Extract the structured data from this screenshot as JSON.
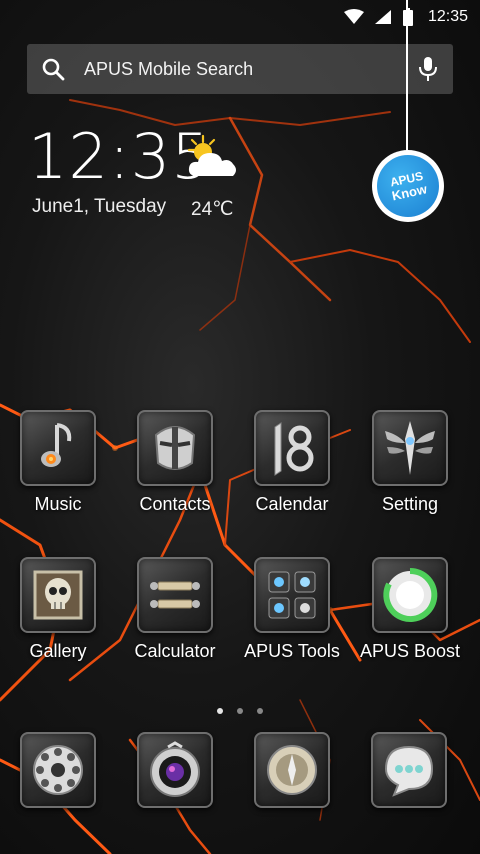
{
  "status_bar": {
    "time": "12:35",
    "icons": [
      "wifi-icon",
      "cell-signal-icon",
      "battery-icon"
    ]
  },
  "search": {
    "placeholder": "APUS Mobile Search",
    "icons": [
      "search-icon",
      "mic-icon"
    ]
  },
  "clock_widget": {
    "time": "12:35",
    "date": "June1, Tuesday",
    "temperature": "24℃",
    "weather_icon": "partly-cloudy-icon"
  },
  "apus_know": {
    "line1": "APUS",
    "line2": "Know"
  },
  "apps": [
    {
      "label": "Music",
      "icon": "music-note-icon"
    },
    {
      "label": "Contacts",
      "icon": "knight-helmet-icon"
    },
    {
      "label": "Calendar",
      "icon": "calendar-18-icon"
    },
    {
      "label": "Setting",
      "icon": "winged-blade-icon"
    },
    {
      "label": "Gallery",
      "icon": "skull-frame-icon"
    },
    {
      "label": "Calculator",
      "icon": "scroll-bars-icon"
    },
    {
      "label": "APUS Tools",
      "icon": "tools-grid-icon"
    },
    {
      "label": "APUS Boost",
      "icon": "boost-ring-icon"
    }
  ],
  "page_indicator": {
    "count": 3,
    "active": 0
  },
  "dock": [
    {
      "icon": "phone-dialer-icon"
    },
    {
      "icon": "camera-lens-icon"
    },
    {
      "icon": "browser-compass-icon"
    },
    {
      "icon": "messages-bubble-icon"
    }
  ],
  "colors": {
    "background": "#111111",
    "lava": "#e04a10",
    "apus_blue": "#1b8fe0",
    "boost_green": "#4ecf5a"
  }
}
